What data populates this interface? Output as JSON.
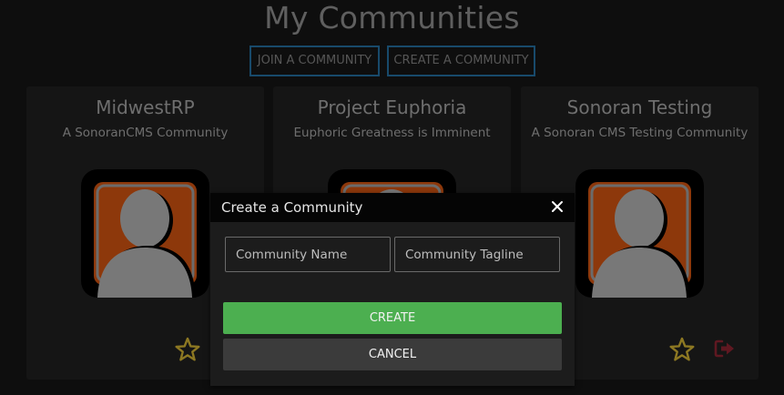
{
  "header": {
    "title": "My Communities",
    "join_label": "JOIN A COMMUNITY",
    "create_label": "CREATE A COMMUNITY"
  },
  "communities": [
    {
      "name": "MidwestRP",
      "tagline": "A SonoranCMS Community",
      "avatar_icon": "default-user-avatar-icon"
    },
    {
      "name": "Project Euphoria",
      "tagline": "Euphoric Greatness is Imminent",
      "avatar_icon": "default-user-avatar-icon"
    },
    {
      "name": "Sonoran Testing",
      "tagline": "A Sonoran CMS Testing Community",
      "avatar_icon": "default-user-avatar-icon"
    }
  ],
  "modal": {
    "title": "Create a Community",
    "name_placeholder": "Community Name",
    "tagline_placeholder": "Community Tagline",
    "create_label": "CREATE",
    "cancel_label": "CANCEL"
  },
  "colors": {
    "accent_border": "#1f5f8a",
    "create_green": "#4caf50",
    "star_gold": "#b59a2c",
    "logout_red": "#7a1f2b",
    "avatar_orange": "#b5480f"
  }
}
